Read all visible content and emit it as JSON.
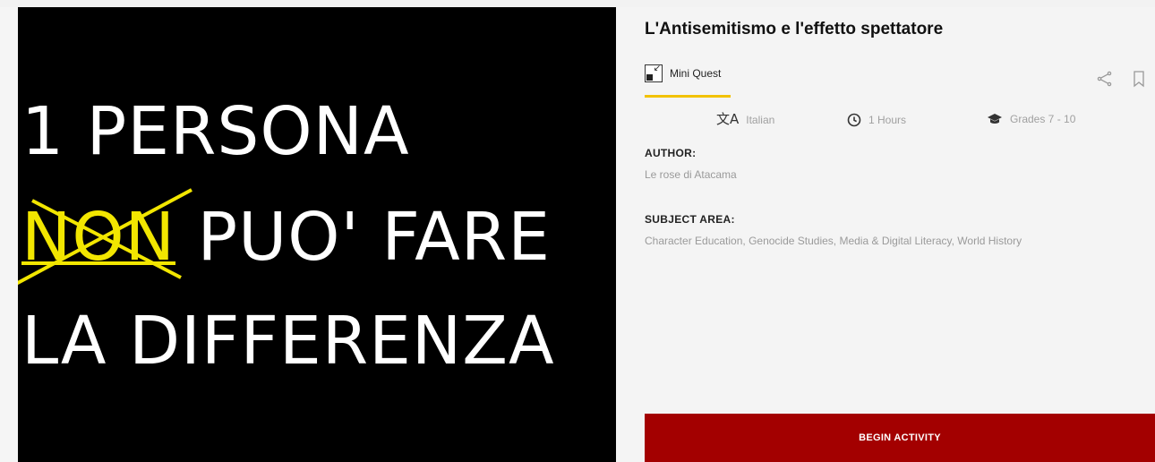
{
  "hero": {
    "line1": "1 PERSONA",
    "line2_struck": "NON",
    "line2_rest": " PUO' FARE",
    "line3": "LA DIFFERENZA"
  },
  "activity": {
    "title": "L'Antisemitismo e l'effetto spettatore",
    "type_label": "Mini Quest",
    "type_icon": "mini-quest-icon",
    "language": "Italian",
    "duration": "1 Hours",
    "grades": "Grades 7 - 10",
    "author_label": "AUTHOR:",
    "author_value": "Le rose di Atacama",
    "subject_label": "SUBJECT AREA:",
    "subject_value": "Character Education, Genocide Studies, Media & Digital Literacy, World History",
    "begin_label": "BEGIN ACTIVITY"
  },
  "icons": {
    "share": "share-icon",
    "bookmark": "bookmark-icon",
    "language": "translate-icon",
    "duration": "clock-icon",
    "grades": "graduation-cap-icon"
  },
  "colors": {
    "accent_yellow": "#f2e600",
    "tab_underline": "#f2c200",
    "button_red": "#a30000",
    "hero_bg": "#000000"
  }
}
